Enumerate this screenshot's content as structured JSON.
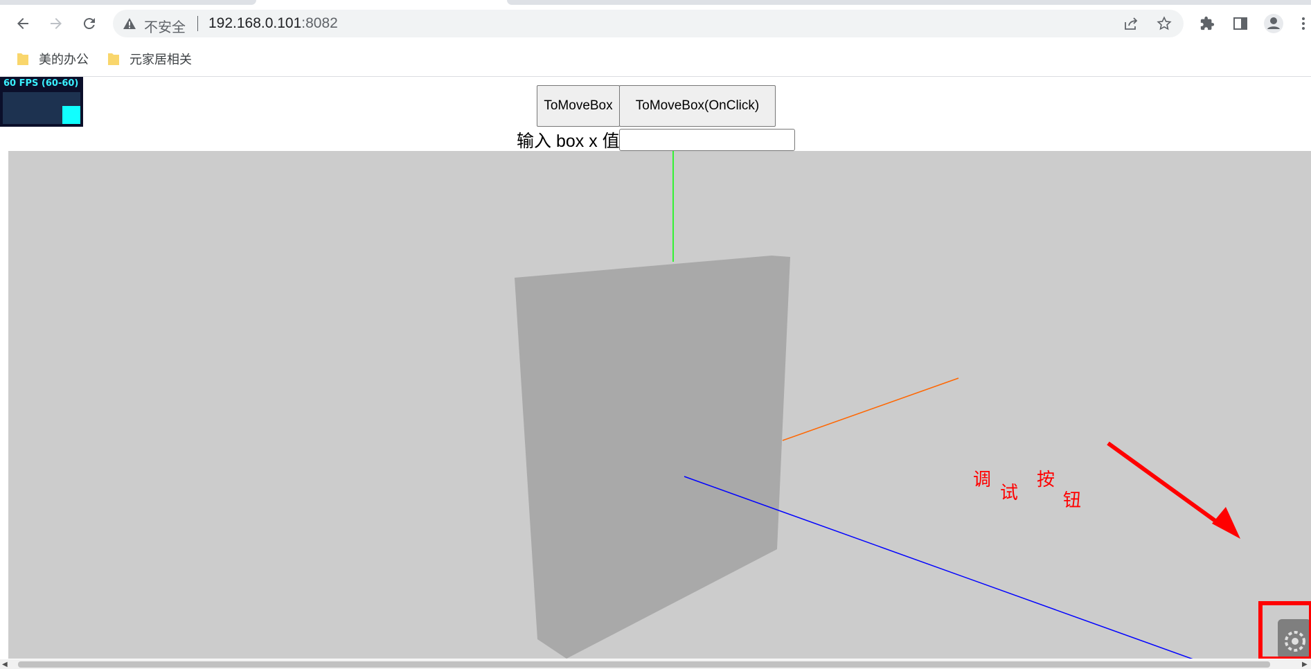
{
  "browser": {
    "security_label": "不安全",
    "url_host": "192.168.0.101",
    "url_port": ":8082",
    "icons": [
      "back-icon",
      "forward-icon",
      "reload-icon",
      "warning-icon",
      "share-icon",
      "star-icon",
      "extensions-icon",
      "side-panel-icon",
      "profile-icon",
      "menu-icon"
    ]
  },
  "bookmarks": [
    {
      "label": "美的办公"
    },
    {
      "label": "元家居相关"
    }
  ],
  "page": {
    "fps_label": "60 FPS (60-60)",
    "buttons": {
      "move_box": "ToMoveBox",
      "move_box_onclick": "ToMoveBox(OnClick)"
    },
    "input_label": "输入 box x 值",
    "input_value": "",
    "annotation_chars": [
      "调",
      "试",
      "按",
      "钮"
    ]
  },
  "colors": {
    "scene_bg": "#cccccc",
    "box_color": "#a9a9a9",
    "axis_y": "#00ff00",
    "axis_x": "#ff6600",
    "axis_z": "#0000ff",
    "annotation": "#ff0000",
    "fps_text": "#3af0ff"
  }
}
